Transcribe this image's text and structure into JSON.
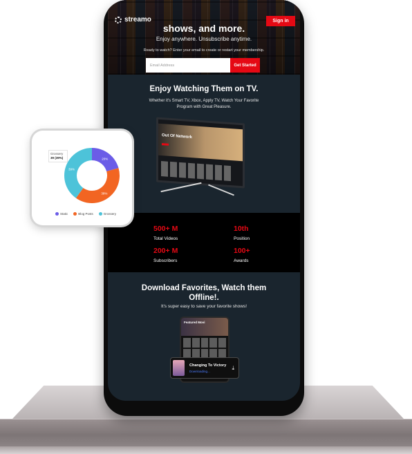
{
  "header": {
    "logo": "streamo",
    "signin": "Sign in"
  },
  "hero": {
    "title": "shows, and more.",
    "subtitle": "Enjoy anywhere. Unsubscribe anytime.",
    "cta_text": "Ready to watch? Enter your email to create or restart your membership.",
    "email_placeholder": "Email Address",
    "button": "Get Started"
  },
  "tv_section": {
    "title": "Enjoy Watching Them on TV.",
    "description": "Whether it's Smart TV, Xbox, Apply TV, Watch Your Favorite Program with Great Pleasure.",
    "screen_show": "Out Of Network"
  },
  "stats": [
    {
      "value": "500+ M",
      "label": "Total Videos"
    },
    {
      "value": "10th",
      "label": "Position"
    },
    {
      "value": "200+ M",
      "label": "Subscribers"
    },
    {
      "value": "100+",
      "label": "Awards"
    }
  ],
  "download_section": {
    "title": "Download Favorites, Watch them Offline!.",
    "subtitle": "It's super easy to save your favorite shows!",
    "mini_banner": "Featured Movi",
    "card_title": "Changing To Victory",
    "card_status": "Downloading..."
  },
  "colors": {
    "accent": "#e50914",
    "screen_bg": "#1a252e",
    "stats_bg": "#000000"
  },
  "chart_data": {
    "type": "pie",
    "donut": true,
    "categories": [
      "Static",
      "Blog Posts",
      "Grossery"
    ],
    "values": [
      20,
      38,
      39
    ],
    "slice_labels": [
      "20%",
      "38%",
      "39%"
    ],
    "colors": [
      "#6b5ce7",
      "#f26522",
      "#4dc3d9"
    ],
    "tooltip": {
      "category": "Grossery",
      "value": "39 (39%)"
    },
    "legend_position": "bottom"
  }
}
